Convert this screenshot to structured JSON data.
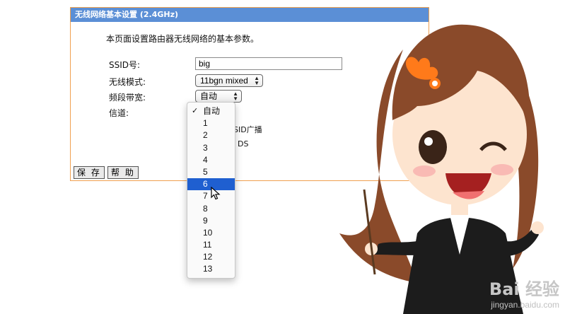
{
  "panel": {
    "title": "无线网络基本设置 (2.4GHz)",
    "description": "本页面设置路由器无线网络的基本参数。",
    "labels": {
      "ssid": "SSID号:",
      "mode": "无线模式:",
      "bandwidth": "频段带宽:",
      "channel": "信道:"
    },
    "ssid_value": "big",
    "mode_value": "11bgn mixed",
    "bandwidth_value": "自动",
    "partial_ssid_broadcast": "SID广播",
    "partial_wds": "DS",
    "save_label": "保 存",
    "help_label": "帮 助"
  },
  "dropdown": {
    "options": [
      "自动",
      "1",
      "2",
      "3",
      "4",
      "5",
      "6",
      "7",
      "8",
      "9",
      "10",
      "11",
      "12",
      "13"
    ],
    "checked_index": 0,
    "highlighted_index": 6
  },
  "watermark": {
    "logo": "Bai 经验",
    "url": "jingyan.baidu.com"
  },
  "colors": {
    "header_bg": "#5b8fd6",
    "panel_border": "#f0a050",
    "highlight": "#1f5fd0"
  }
}
